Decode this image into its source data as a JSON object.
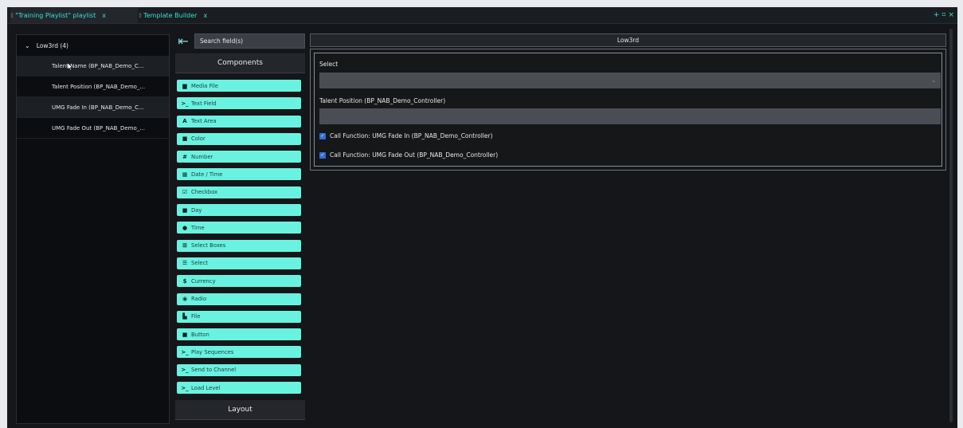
{
  "tabs": [
    {
      "label": "\"Training Playlist\" playlist",
      "close": "x"
    },
    {
      "label": "Template Builder",
      "close": "x"
    }
  ],
  "window_controls": {
    "add": "+",
    "dock": "⌗",
    "close": "×"
  },
  "tree": {
    "header": "Low3rd (4)",
    "items": [
      {
        "label": "Talent Name (BP_NAB_Demo_C..."
      },
      {
        "label": "Talent Position (BP_NAB_Demo_..."
      },
      {
        "label": "UMG Fade In (BP_NAB_Demo_C..."
      },
      {
        "label": "UMG Fade Out (BP_NAB_Demo_..."
      }
    ]
  },
  "components": {
    "search_placeholder": "Search field(s)",
    "header": "Components",
    "items": [
      {
        "icon": "media-file-icon",
        "glyph": "▆",
        "label": "Media File"
      },
      {
        "icon": "terminal-icon",
        "glyph": ">_",
        "label": "Text Field"
      },
      {
        "icon": "text-area-icon",
        "glyph": "A",
        "label": "Text Area"
      },
      {
        "icon": "color-icon",
        "glyph": "■",
        "label": "Color"
      },
      {
        "icon": "number-icon",
        "glyph": "#",
        "label": "Number"
      },
      {
        "icon": "calendar-icon",
        "glyph": "▦",
        "label": "Date / Time"
      },
      {
        "icon": "checkbox-icon",
        "glyph": "☑",
        "label": "Checkbox"
      },
      {
        "icon": "day-icon",
        "glyph": "■",
        "label": "Day"
      },
      {
        "icon": "clock-icon",
        "glyph": "●",
        "label": "Time"
      },
      {
        "icon": "select-boxes-icon",
        "glyph": "⊞",
        "label": "Select Boxes"
      },
      {
        "icon": "select-icon",
        "glyph": "☰",
        "label": "Select"
      },
      {
        "icon": "currency-icon",
        "glyph": "$",
        "label": "Currency"
      },
      {
        "icon": "radio-icon",
        "glyph": "◉",
        "label": "Radio"
      },
      {
        "icon": "file-icon",
        "glyph": "▙",
        "label": "File"
      },
      {
        "icon": "button-icon",
        "glyph": "■",
        "label": "Button"
      },
      {
        "icon": "terminal-icon",
        "glyph": ">_",
        "label": "Play Sequences"
      },
      {
        "icon": "terminal-icon",
        "glyph": ">_",
        "label": "Send to Channel"
      },
      {
        "icon": "terminal-icon",
        "glyph": ">_",
        "label": "Load Level"
      }
    ],
    "layout_header": "Layout"
  },
  "preview": {
    "title": "Low3rd",
    "select_label": "Select",
    "select_value": "",
    "position_label": "Talent Position (BP_NAB_Demo_Controller)",
    "position_value": "",
    "checkboxes": [
      {
        "label": "Call Function: UMG Fade In (BP_NAB_Demo_Controller)",
        "checked": true
      },
      {
        "label": "Call Function: UMG Fade Out (BP_NAB_Demo_Controller)",
        "checked": true
      }
    ]
  },
  "colors": {
    "accent": "#38e0d6",
    "component_button": "#6af2e0",
    "checkbox": "#2f6fd6",
    "background": "#141619"
  }
}
